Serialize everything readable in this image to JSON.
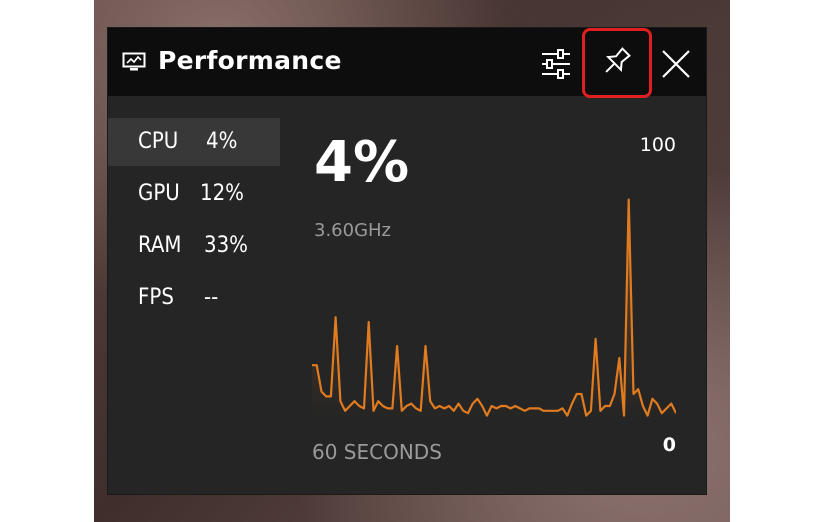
{
  "widget": {
    "title": "Performance",
    "icons": {
      "app": "monitor-icon",
      "settings": "sliders-icon",
      "pin": "pin-icon",
      "close": "close-icon"
    },
    "pin_highlight_color": "#e02020"
  },
  "metrics": [
    {
      "label": "CPU",
      "value": "4%",
      "active": true
    },
    {
      "label": "GPU",
      "value": "12%",
      "active": false
    },
    {
      "label": "RAM",
      "value": "33%",
      "active": false
    },
    {
      "label": "FPS",
      "value": "--",
      "active": false
    }
  ],
  "detail": {
    "current": "4%",
    "frequency": "3.60GHz",
    "axis_max": "100",
    "axis_min": "0",
    "time_window": "60 SECONDS"
  },
  "chart_data": {
    "type": "area",
    "color": "#e07b20",
    "ylim": [
      0,
      100
    ],
    "x_unit": "seconds",
    "values": [
      22,
      22,
      11,
      9,
      9,
      42,
      7,
      3,
      5,
      7,
      5,
      4,
      40,
      3,
      7,
      5,
      4,
      4,
      30,
      3,
      5,
      6,
      4,
      3,
      30,
      7,
      4,
      5,
      4,
      5,
      3,
      6,
      3,
      2,
      6,
      8,
      5,
      1,
      5,
      4,
      5,
      5,
      4,
      5,
      4,
      3,
      4,
      4,
      4,
      3,
      3,
      3,
      3,
      4,
      1,
      6,
      10,
      10,
      1,
      3,
      33,
      3,
      5,
      5,
      10,
      25,
      1,
      91,
      10,
      12,
      5,
      1,
      8,
      6,
      2,
      4,
      6,
      2
    ]
  }
}
